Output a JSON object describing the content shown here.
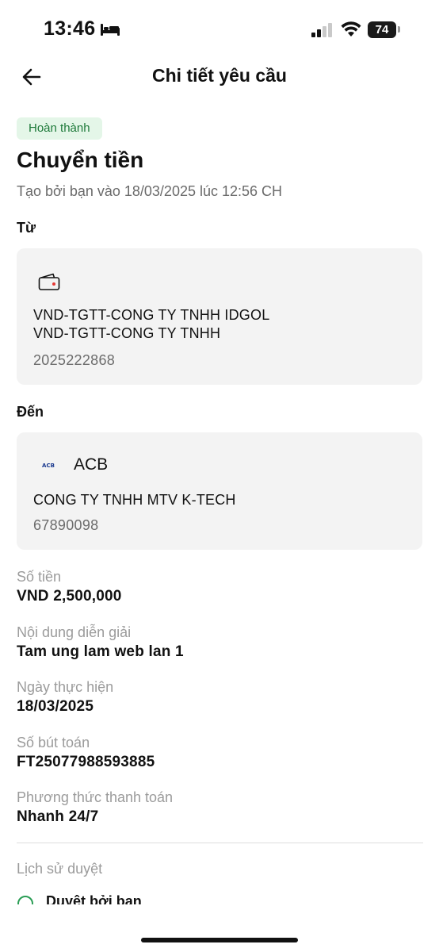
{
  "status_bar": {
    "time": "13:46",
    "battery": "74",
    "icons": [
      "bed-icon",
      "signal-icon",
      "wifi-icon",
      "battery-icon"
    ]
  },
  "header": {
    "back_icon": "arrow-left-icon",
    "title": "Chi tiết yêu cầu"
  },
  "request": {
    "status": "Hoàn thành",
    "title": "Chuyển tiền",
    "created": "Tạo bởi bạn vào 18/03/2025 lúc 12:56 CH"
  },
  "from": {
    "label": "Từ",
    "icon": "wallet-icon",
    "line1": "VND-TGTT-CONG TY TNHH IDGOL",
    "line2": "VND-TGTT-CONG TY TNHH",
    "account": "2025222868"
  },
  "to": {
    "label": "Đến",
    "bank_logo": "ACB",
    "bank_name": "ACB",
    "beneficiary": "CONG TY TNHH MTV K-TECH",
    "account": "67890098"
  },
  "details": [
    {
      "label": "Số tiền",
      "value": "VND 2,500,000"
    },
    {
      "label": "Nội dung diễn giải",
      "value": "Tam ung lam web lan 1"
    },
    {
      "label": "Ngày thực hiện",
      "value": "18/03/2025"
    },
    {
      "label": "Số bút toán",
      "value": "FT25077988593885"
    },
    {
      "label": "Phương thức thanh toán",
      "value": "Nhanh 24/7"
    }
  ],
  "history": {
    "label": "Lịch sử duyệt",
    "first_item": "Duyệt bởi bạn"
  },
  "colors": {
    "badge_bg": "#e4f6e8",
    "badge_text": "#1e7a3a",
    "card_bg": "#f3f3f3",
    "wallet_dot": "#e53935",
    "acb_blue": "#1b3a8f"
  }
}
